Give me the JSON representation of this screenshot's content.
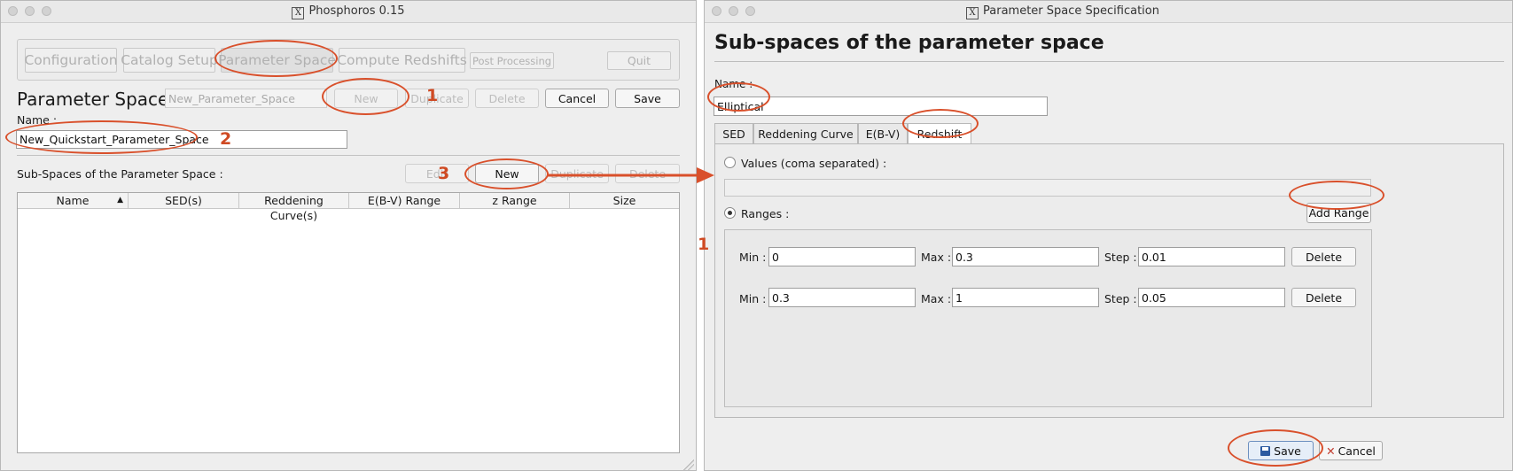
{
  "left_window": {
    "title": "Phosphoros 0.15",
    "nav": [
      "Configuration",
      "Catalog Setup",
      "Parameter Space",
      "Compute Redshifts",
      "Post Processing",
      "Quit"
    ],
    "heading": "Parameter Space :",
    "ps_select_value": "New_Parameter_Space",
    "buttons": {
      "new": "New",
      "duplicate": "Duplicate",
      "delete": "Delete",
      "cancel": "Cancel",
      "save": "Save"
    },
    "name_label": "Name :",
    "name_value": "New_Quickstart_Parameter_Space",
    "subspaces_label": "Sub-Spaces of the Parameter Space :",
    "sub_buttons": {
      "edit": "Edit",
      "new": "New",
      "duplicate": "Duplicate",
      "delete": "Delete"
    },
    "table_columns": [
      "Name",
      "SED(s)",
      "Reddening Curve(s)",
      "E(B-V) Range",
      "z Range",
      "Size"
    ]
  },
  "annotations": {
    "step1": "1",
    "step2": "2",
    "step3": "3",
    "margin_mark": "1"
  },
  "right_window": {
    "title": "Parameter Space Specification",
    "heading": "Sub-spaces of the parameter space",
    "name_label": "Name :",
    "name_value": "Elliptical",
    "tabs": [
      "SED",
      "Reddening Curve",
      "E(B-V)",
      "Redshift"
    ],
    "values_label": "Values (coma separated) :",
    "values_input": "",
    "ranges_label": "Ranges :",
    "add_range": "Add Range",
    "ranges": [
      {
        "min_label": "Min :",
        "min": "0",
        "max_label": "Max :",
        "max": "0.3",
        "step_label": "Step :",
        "step": "0.01",
        "delete": "Delete"
      },
      {
        "min_label": "Min :",
        "min": "0.3",
        "max_label": "Max :",
        "max": "1",
        "step_label": "Step :",
        "step": "0.05",
        "delete": "Delete"
      }
    ],
    "save": "Save",
    "cancel": "Cancel"
  },
  "colors": {
    "annotation": "#d9502b"
  }
}
